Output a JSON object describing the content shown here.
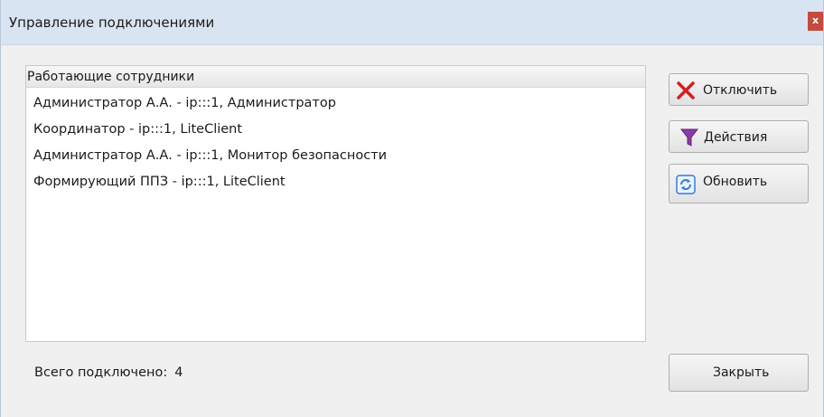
{
  "window": {
    "title": "Управление подключениями",
    "close_label": "x"
  },
  "list": {
    "header": "Работающие сотрудники",
    "items": [
      "Администратор А.А. - ip:::1, Администратор",
      "Координатор - ip:::1, LiteClient",
      "Администратор А.А. - ip:::1, Монитор безопасности",
      "Формирующий ППЗ - ip:::1, LiteClient"
    ]
  },
  "buttons": {
    "disconnect": "Отключить",
    "actions": "Действия",
    "refresh": "Обновить",
    "close": "Закрыть"
  },
  "footer": {
    "total_label": "Всего подключено:",
    "total_value": "4"
  },
  "colors": {
    "titlebar": "#d9e4f2",
    "close_button": "#c64a3d",
    "disconnect_icon": "#d42020",
    "filter_icon": "#8a3aa8",
    "refresh_icon": "#3a7bd5"
  },
  "icons": {
    "disconnect": "red-x-icon",
    "actions": "funnel-icon",
    "refresh": "refresh-icon"
  }
}
